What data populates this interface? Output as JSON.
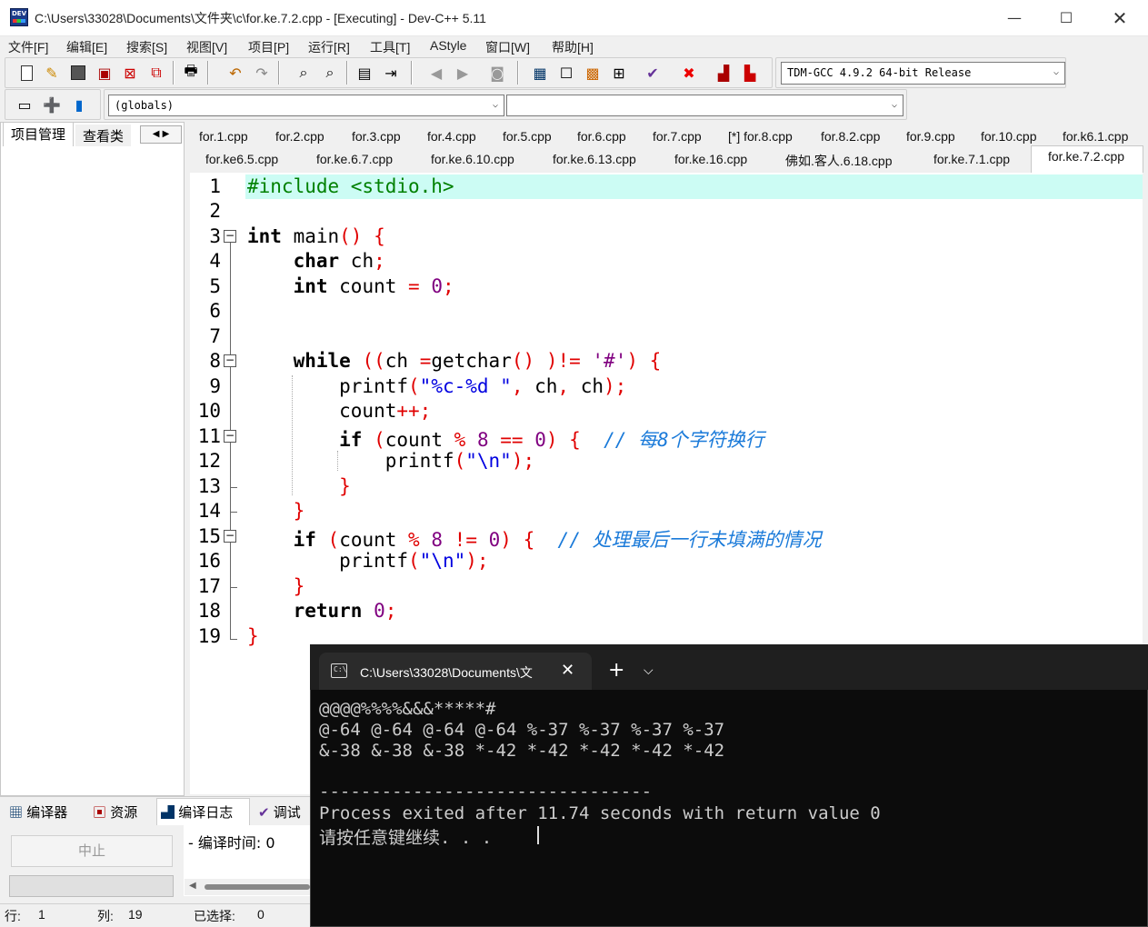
{
  "window": {
    "title": "C:\\Users\\33028\\Documents\\文件夹\\c\\for.ke.7.2.cpp - [Executing] - Dev-C++ 5.11"
  },
  "menu": [
    "文件[F]",
    "编辑[E]",
    "搜索[S]",
    "视图[V]",
    "项目[P]",
    "运行[R]",
    "工具[T]",
    "AStyle",
    "窗口[W]",
    "帮助[H]"
  ],
  "toolbar": {
    "compiler_select": "TDM-GCC 4.9.2 64-bit Release",
    "scope_select": "(globals)",
    "symbol_select": ""
  },
  "left_tabs": [
    "项目管理",
    "查看类"
  ],
  "file_tabs_row1": [
    "for.1.cpp",
    "for.2.cpp",
    "for.3.cpp",
    "for.4.cpp",
    "for.5.cpp",
    "for.6.cpp",
    "for.7.cpp",
    "[*] for.8.cpp",
    "for.8.2.cpp",
    "for.9.cpp",
    "for.10.cpp",
    "for.k6.1.cpp"
  ],
  "file_tabs_row2": [
    "for.ke6.5.cpp",
    "for.ke.6.7.cpp",
    "for.ke.6.10.cpp",
    "for.ke.6.13.cpp",
    "for.ke.16.cpp",
    "佛如.客人.6.18.cpp",
    "for.ke.7.1.cpp",
    "for.ke.7.2.cpp"
  ],
  "code_lines": [
    "1",
    "2",
    "3",
    "4",
    "5",
    "6",
    "7",
    "8",
    "9",
    "10",
    "11",
    "12",
    "13",
    "14",
    "15",
    "16",
    "17",
    "18",
    "19"
  ],
  "code": {
    "l1": "#include <stdio.h>",
    "comment1": "// 每8个字符换行",
    "comment2": "// 处理最后一行未填满的情况"
  },
  "console": {
    "tab_title": "C:\\Users\\33028\\Documents\\文",
    "lines": [
      "@@@@%%%%&&&*****#",
      "@-64 @-64 @-64 @-64 %-37 %-37 %-37 %-37",
      "&-38 &-38 &-38 *-42 *-42 *-42 *-42 *-42",
      "",
      "--------------------------------",
      "Process exited after 11.74 seconds with return value 0",
      "请按任意键继续. . . "
    ]
  },
  "bottom_tabs": [
    "编译器",
    "资源",
    "编译日志",
    "调试"
  ],
  "bottom_panel": {
    "stop_button": "中止",
    "compile_time": "- 编译时间: 0"
  },
  "status": {
    "row_label": "行:",
    "row": "1",
    "col_label": "列:",
    "col": "19",
    "sel_label": "已选择:",
    "sel": "0"
  }
}
